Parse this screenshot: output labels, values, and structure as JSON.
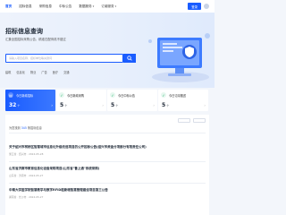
{
  "nav": {
    "items": [
      {
        "label": "首页",
        "active": true,
        "dropdown": false
      },
      {
        "label": "招标信息",
        "active": false,
        "dropdown": false
      },
      {
        "label": "采购信息",
        "active": false,
        "dropdown": false
      },
      {
        "label": "中标公告",
        "active": false,
        "dropdown": false
      },
      {
        "label": "数据服务",
        "active": false,
        "dropdown": true
      },
      {
        "label": "订阅服务",
        "active": false,
        "dropdown": true
      }
    ],
    "login_label": "登录"
  },
  "hero": {
    "title": "招标信息查询",
    "subtitle": "汇集全国招标采购公告，精准匹配商机不错过",
    "search_placeholder": "请输入项目名称、招标单位等关键词",
    "tags": [
      "建筑",
      "信息化",
      "物业",
      "广告",
      "医疗",
      "交通"
    ]
  },
  "stats": [
    {
      "label": "今日新增招标",
      "value": "32",
      "unit": "个",
      "style": "blue"
    },
    {
      "label": "今日新增采购",
      "value": "5",
      "unit": "个",
      "style": "white"
    },
    {
      "label": "今日中标公告",
      "value": "5",
      "unit": "个",
      "style": "white"
    },
    {
      "label": "今日订阅推送",
      "value": "5",
      "unit": "个",
      "style": "white"
    }
  ],
  "results": {
    "head_prefix": "为您找到",
    "head_count": "345",
    "head_suffix": "条招标信息",
    "items": [
      {
        "title": "关于绍兴市柯桥区智慧城市信息化升级改造项目的公开招标公告(绍兴市资金分项部分有限责任公司)",
        "meta": "浙江省 · 绍兴市 · 2024-05-28",
        "status": "进行中"
      },
      {
        "title": "山东省济南市教育信息化设备采购项目(山东省\"鲁上通\"系统采购)",
        "meta": "山东省 · 济南市 · 2024-05-27",
        "status": "进行中"
      },
      {
        "title": "中南大学医学院智慧教学与数字RFID柜新增智慧管理建设项目第三公告",
        "meta": "湖南省 · 长沙市 · 2024-05-27",
        "status": "进行中"
      }
    ]
  }
}
